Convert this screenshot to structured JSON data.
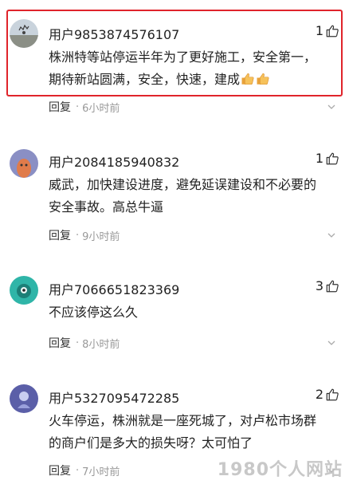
{
  "comments": [
    {
      "username": "用户9853874576107",
      "likes": "1",
      "text_line1": "株洲特等站停运半年为了更好施工，安全第一，",
      "text_line2": "期待新站圆满，安全，快速，建成",
      "reply_label": "回复",
      "time": "6小时前",
      "highlighted": true
    },
    {
      "username": "用户2084185940832",
      "likes": "1",
      "text_line1": "威武，加快建设进度，避免延误建设和不必要的",
      "text_line2": "安全事故。高总牛逼",
      "reply_label": "回复",
      "time": "9小时前"
    },
    {
      "username": "用户7066651823369",
      "likes": "3",
      "text_line1": "不应该停这么久",
      "reply_label": "回复",
      "time": "8小时前"
    },
    {
      "username": "用户5327095472285",
      "likes": "2",
      "text_line1": "火车停运，株洲就是一座死城了，对卢松市场群",
      "text_line2": "的商户们是多大的损失呀？太可怕了",
      "reply_label": "回复",
      "time": "7小时前"
    }
  ],
  "watermark": "1980个人网站",
  "colors": {
    "highlight_border": "#e0242b",
    "meta_gray": "#999999",
    "text": "#222222"
  },
  "icons": [
    "thumbs-up-icon",
    "thumbs-up-emoji-icon",
    "more-chevron-icon"
  ]
}
